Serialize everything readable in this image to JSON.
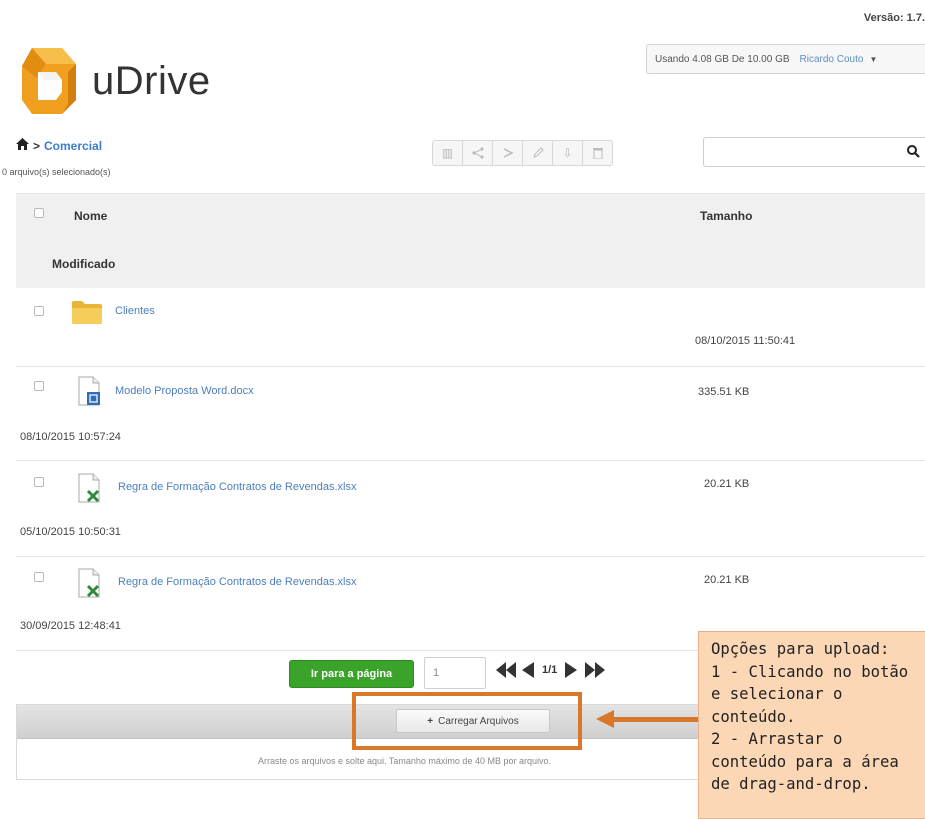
{
  "header": {
    "version": "Versão: 1.7.",
    "app_name": "uDrive",
    "usage_text": "Usando 4.08 GB De 10.00 GB",
    "user_name": "Ricardo Couto",
    "colors": {
      "logo_orange": "#f0a01e",
      "logo_orange_dark": "#d27f10",
      "link_blue": "#3d7cc9"
    }
  },
  "breadcrumb": {
    "home_icon": "home-icon",
    "separator": ">",
    "folder": "Comercial"
  },
  "selection_status": "0 arquivo(s) selecionado(s)",
  "toolbar": {
    "buttons": [
      "copy-icon",
      "share-icon",
      "move-icon",
      "edit-icon",
      "download-icon",
      "trash-icon"
    ]
  },
  "search": {
    "placeholder": "",
    "icon": "search-icon"
  },
  "table": {
    "headers": {
      "name": "Nome",
      "size": "Tamanho",
      "modified": "Modificado"
    },
    "rows": [
      {
        "icon": "folder-icon",
        "name": "Clientes",
        "size": "",
        "modified": "08/10/2015 11:50:41"
      },
      {
        "icon": "word-file-icon",
        "name": "Modelo Proposta Word.docx",
        "size": "335.51 KB",
        "modified": "08/10/2015 10:57:24"
      },
      {
        "icon": "excel-file-icon",
        "name": "Regra de Formação Contratos de Revendas.xlsx",
        "size": "20.21 KB",
        "modified": "05/10/2015 10:50:31"
      },
      {
        "icon": "excel-file-icon",
        "name": "Regra de Formação Contratos de Revendas.xlsx",
        "size": "20.21 KB",
        "modified": "30/09/2015 12:48:41"
      }
    ]
  },
  "pagination": {
    "goto_label": "Ir para a página",
    "page_value": "1",
    "page_text": "1/1",
    "colors": {
      "goto_green": "#3aa32a"
    }
  },
  "upload": {
    "button_label": "Carregar Arquivos",
    "drop_text": "Arraste os arquivos e solte aqui. Tamanho máximo de 40 MB por arquivo."
  },
  "annotation": {
    "lines": [
      "Opções para upload:",
      "1 - Clicando no botão",
      "e selecionar o",
      "conteúdo.",
      "2 - Arrastar o",
      "conteúdo para a área",
      "de drag-and-drop."
    ],
    "colors": {
      "box": "#fbd7b6",
      "outline": "#d8782a"
    }
  }
}
